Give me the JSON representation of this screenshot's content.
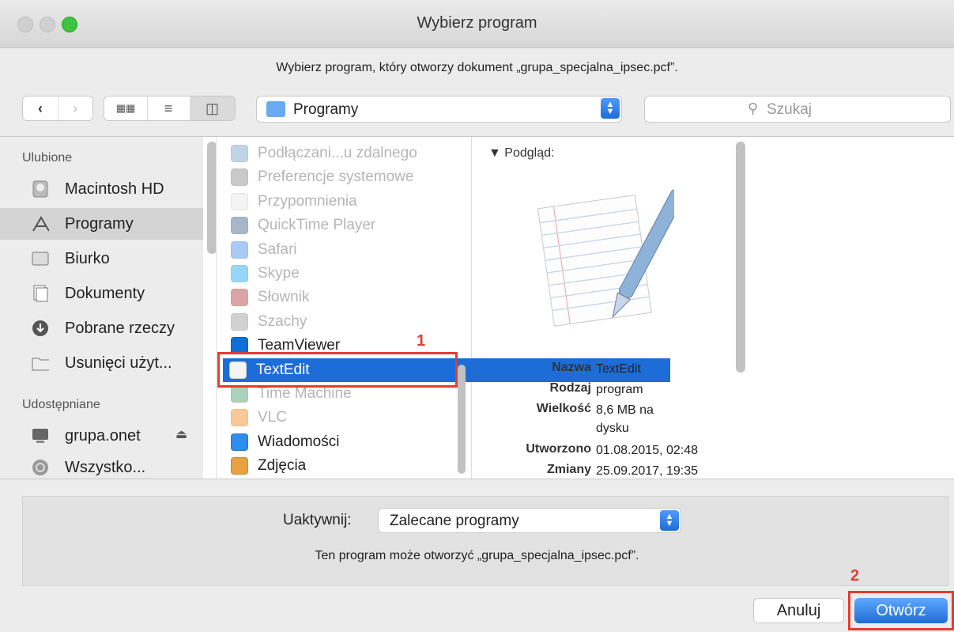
{
  "window": {
    "title": "Wybierz program",
    "prompt": "Wybierz program, który otworzy dokument „grupa_specjalna_ipsec.pcf”."
  },
  "toolbar": {
    "location": "Programy",
    "search_placeholder": "Szukaj"
  },
  "sidebar": {
    "favorites_header": "Ulubione",
    "shared_header": "Udostępniane",
    "favorites": [
      {
        "label": "Macintosh HD",
        "icon": "hard-drive-icon"
      },
      {
        "label": "Programy",
        "icon": "applications-icon"
      },
      {
        "label": "Biurko",
        "icon": "desktop-icon"
      },
      {
        "label": "Dokumenty",
        "icon": "documents-icon"
      },
      {
        "label": "Pobrane rzeczy",
        "icon": "downloads-icon"
      },
      {
        "label": "Usunięci użyt...",
        "icon": "folder-icon"
      }
    ],
    "shared": [
      {
        "label": "grupa.onet",
        "icon": "computer-icon"
      },
      {
        "label": "Wszystko...",
        "icon": "network-icon"
      }
    ]
  },
  "apps": [
    {
      "name": "Podłączani...u zdalnego",
      "enabled": false,
      "color": "#7aa0c8"
    },
    {
      "name": "Preferencje systemowe",
      "enabled": false,
      "color": "#8a8a8a"
    },
    {
      "name": "Przypomnienia",
      "enabled": false,
      "color": "#e8e8e8"
    },
    {
      "name": "QuickTime Player",
      "enabled": false,
      "color": "#3d5f86"
    },
    {
      "name": "Safari",
      "enabled": false,
      "color": "#3d8de8"
    },
    {
      "name": "Skype",
      "enabled": false,
      "color": "#1aa7ec"
    },
    {
      "name": "Słownik",
      "enabled": false,
      "color": "#b23a3a"
    },
    {
      "name": "Szachy",
      "enabled": false,
      "color": "#9a9a9a"
    },
    {
      "name": "TeamViewer",
      "enabled": true,
      "color": "#0e6fd6"
    },
    {
      "name": "TextEdit",
      "enabled": true,
      "color": "#f4f4f4"
    },
    {
      "name": "Time Machine",
      "enabled": false,
      "color": "#4a9a6a"
    },
    {
      "name": "VLC",
      "enabled": false,
      "color": "#f08a1a"
    },
    {
      "name": "Wiadomości",
      "enabled": true,
      "color": "#2f8cf0"
    },
    {
      "name": "Zdjęcia",
      "enabled": true,
      "color": "#e8a040"
    }
  ],
  "preview": {
    "header": "Podgląd:",
    "fields": [
      {
        "label": "Nazwa",
        "value": "TextEdit"
      },
      {
        "label": "Rodzaj",
        "value": "program"
      },
      {
        "label": "Wielkość",
        "value": "8,6 MB na dysku"
      },
      {
        "label": "Utworzono",
        "value": "01.08.2015, 02:48"
      },
      {
        "label": "Zmiany",
        "value": "25.09.2017, 19:35"
      }
    ]
  },
  "footer": {
    "enable_label": "Uaktywnij:",
    "enable_value": "Zalecane programy",
    "note": "Ten program może otworzyć „grupa_specjalna_ipsec.pcf”.",
    "cancel": "Anuluj",
    "open": "Otwórz"
  },
  "annotations": {
    "step1": "1",
    "step2": "2"
  },
  "colors": {
    "accent": "#1d6dd8",
    "highlight": "#e33d2e"
  }
}
